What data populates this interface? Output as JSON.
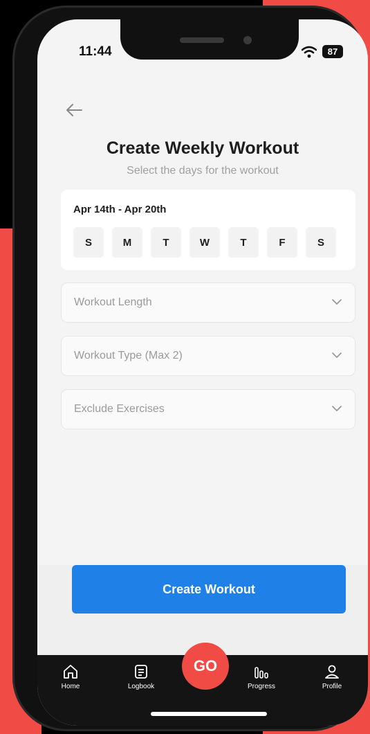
{
  "status": {
    "time": "11:44",
    "battery": "87"
  },
  "header": {
    "title": "Create Weekly Workout",
    "subtitle": "Select the days for the workout"
  },
  "week": {
    "range": "Apr 14th - Apr 20th",
    "days": [
      "S",
      "M",
      "T",
      "W",
      "T",
      "F",
      "S"
    ]
  },
  "dropdowns": {
    "length": "Workout Length",
    "type": "Workout Type (Max 2)",
    "exclude": "Exclude Exercises"
  },
  "actions": {
    "create_label": "Create Workout"
  },
  "tabbar": {
    "home": "Home",
    "logbook": "Logbook",
    "go": "GO",
    "progress": "Progress",
    "profile": "Profile"
  },
  "colors": {
    "accent": "#1f80e8",
    "brand": "#f04b45"
  },
  "icons": [
    "back-arrow-icon",
    "wifi-icon",
    "chevron-down-icon",
    "home-icon",
    "logbook-icon",
    "progress-icon",
    "profile-icon"
  ]
}
